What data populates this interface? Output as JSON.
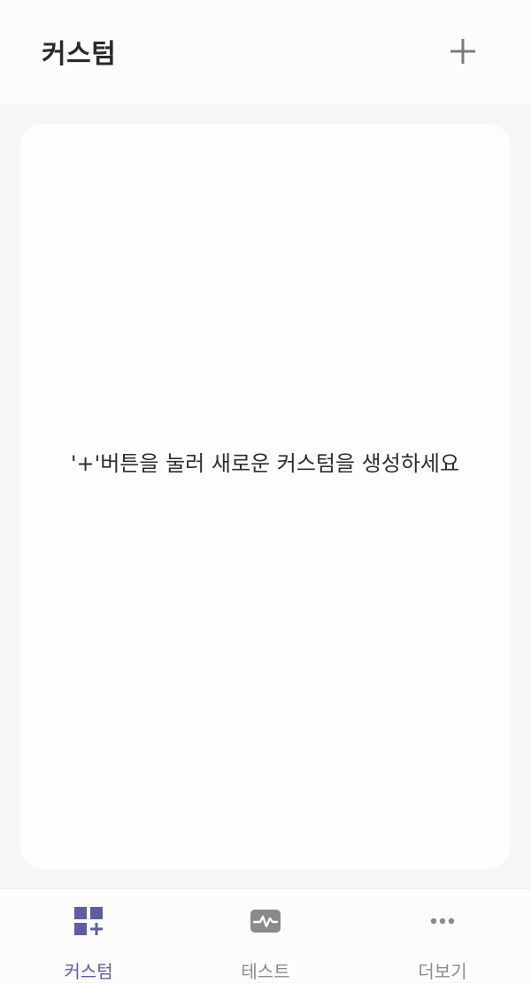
{
  "header": {
    "title": "커스텀",
    "add_icon": "plus-icon"
  },
  "main": {
    "empty_message": "'+'버튼을 눌러 새로운 커스텀을 생성하세요"
  },
  "tabbar": {
    "active_tab": "custom",
    "tabs": [
      {
        "id": "custom",
        "label": "커스텀",
        "icon": "grid-plus-icon"
      },
      {
        "id": "test",
        "label": "테스트",
        "icon": "pulse-icon"
      },
      {
        "id": "more",
        "label": "더보기",
        "icon": "more-dots-icon"
      }
    ]
  },
  "colors": {
    "accent": "#5b5ea6",
    "inactive": "#8c8c8c",
    "background": "#f7f7f8",
    "surface": "#fdfcfd"
  }
}
